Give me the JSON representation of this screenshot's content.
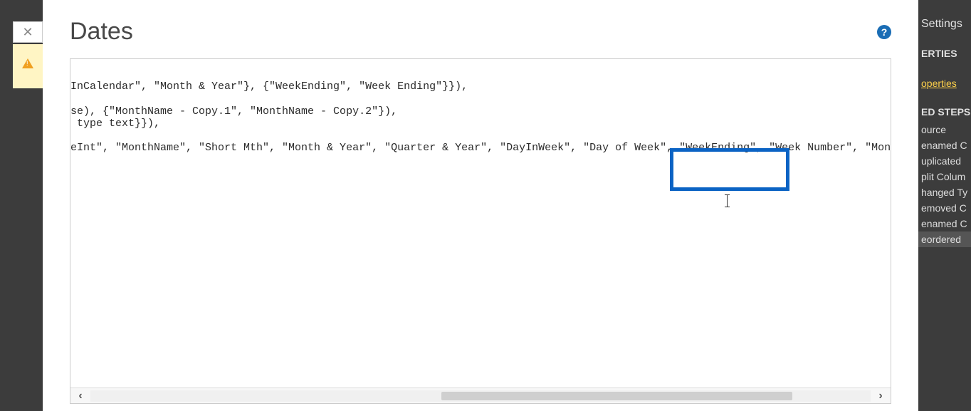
{
  "title": "Dates",
  "help_tooltip": "?",
  "code": {
    "line1": "InCalendar\", \"Month & Year\"}, {\"WeekEnding\", \"Week Ending\"}}),",
    "line2": "se), {\"MonthName - Copy.1\", \"MonthName - Copy.2\"}),",
    "line3": " type text}}),",
    "line4": "eInt\", \"MonthName\", \"Short Mth\", \"Month & Year\", \"Quarter & Year\", \"DayInWeek\", \"Day of Week\", \"WeekEnding\", \"Week Number\", \"MonthnYear\", \"Quar"
  },
  "rightPanel": {
    "settings": "Settings",
    "properties": "ERTIES",
    "name_placeholder": "",
    "all_properties": "operties",
    "applied_steps": "ED STEPS",
    "steps": [
      "ource",
      "enamed C",
      "uplicated",
      "plit Colum",
      "hanged Ty",
      "emoved C",
      "enamed C",
      "eordered"
    ]
  },
  "scroll": {
    "left": "‹",
    "right": "›"
  }
}
